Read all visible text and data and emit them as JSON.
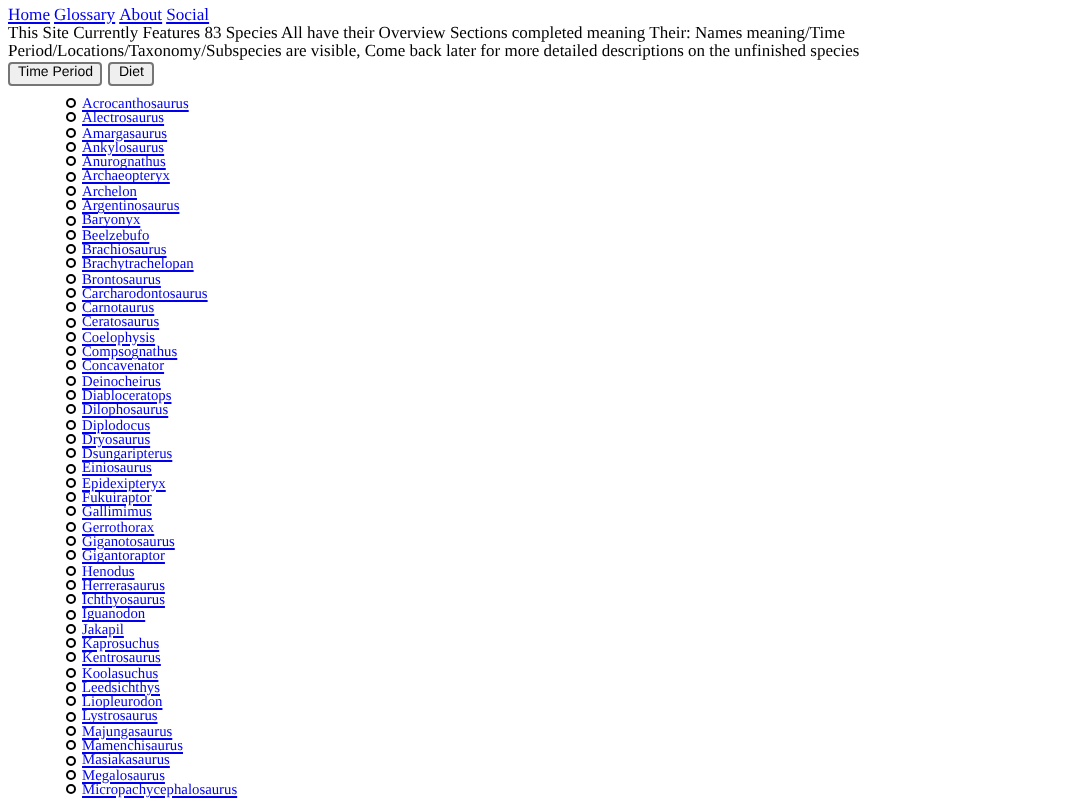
{
  "nav": {
    "links": [
      "Home",
      "Glossary",
      "About",
      "Social"
    ]
  },
  "intro": "This Site Currently Features 83 Species All have their Overview Sections completed meaning Their: Names meaning/Time Period/Locations/Taxonomy/Subspecies are visible, Come back later for more detailed descriptions on the unfinished species",
  "buttons": [
    "Time Period",
    "Diet"
  ],
  "species": [
    "Acrocanthosaurus",
    "Alectrosaurus",
    "Amargasaurus",
    "Ankylosaurus",
    "Anurognathus",
    "Archaeopteryx",
    "Archelon",
    "Argentinosaurus",
    "Baryonyx",
    "Beelzebufo",
    "Brachiosaurus",
    "Brachytrachelopan",
    "Brontosaurus",
    "Carcharodontosaurus",
    "Carnotaurus",
    "Ceratosaurus",
    "Coelophysis",
    "Compsognathus",
    "Concavenator",
    "Deinocheirus",
    "Diabloceratops",
    "Dilophosaurus",
    "Diplodocus",
    "Dryosaurus",
    "Dsungaripterus",
    "Einiosaurus",
    "Epidexipteryx",
    "Fukuiraptor",
    "Gallimimus",
    "Gerrothorax",
    "Giganotosaurus",
    "Gigantoraptor",
    "Henodus",
    "Herrerasaurus",
    "Ichthyosaurus",
    "Iguanodon",
    "Jakapil",
    "Kaprosuchus",
    "Kentrosaurus",
    "Koolasuchus",
    "Leedsichthys",
    "Liopleurodon",
    "Lystrosaurus",
    "Majungasaurus",
    "Mamenchisaurus",
    "Masiakasaurus",
    "Megalosaurus",
    "Micropachycephalosaurus"
  ]
}
